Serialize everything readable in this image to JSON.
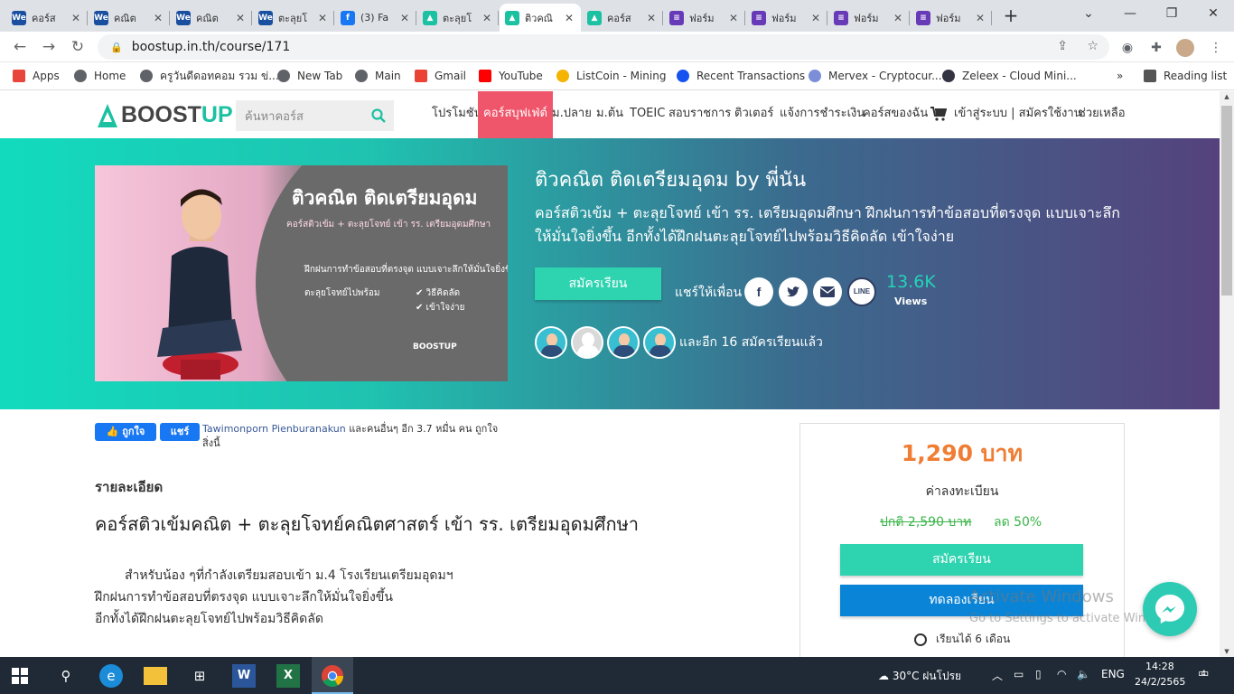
{
  "browser": {
    "tabs": [
      {
        "label": "คอร์ส",
        "icon": "we-icon",
        "color": "#1a4fa0"
      },
      {
        "label": "คณิต",
        "icon": "we-icon",
        "color": "#1a4fa0"
      },
      {
        "label": "คณิต",
        "icon": "we-icon",
        "color": "#1a4fa0"
      },
      {
        "label": "ตะลุยโ",
        "icon": "we-icon",
        "color": "#1a4fa0"
      },
      {
        "label": "(3) Fa",
        "icon": "facebook-icon",
        "color": "#1877f2"
      },
      {
        "label": "ตะลุยโ",
        "icon": "boostup-icon",
        "color": "#1bc1a1"
      },
      {
        "label": "ติวคณิ",
        "icon": "boostup-icon",
        "color": "#1bc1a1",
        "active": true
      },
      {
        "label": "คอร์ส",
        "icon": "boostup-icon",
        "color": "#1bc1a1"
      },
      {
        "label": "ฟอร์ม",
        "icon": "forms-icon",
        "color": "#673ab7"
      },
      {
        "label": "ฟอร์ม",
        "icon": "forms-icon",
        "color": "#673ab7"
      },
      {
        "label": "ฟอร์ม",
        "icon": "forms-icon",
        "color": "#673ab7"
      },
      {
        "label": "ฟอร์ม",
        "icon": "forms-icon",
        "color": "#673ab7"
      }
    ],
    "url": "boostup.in.th/course/171",
    "bookmarks": [
      {
        "label": "Apps",
        "icon": "apps-grid-icon"
      },
      {
        "label": "Home",
        "icon": "globe-icon"
      },
      {
        "label": "ครูวันดีดอทคอม รวม ข่...",
        "icon": "globe-icon"
      },
      {
        "label": "New Tab",
        "icon": "globe-icon"
      },
      {
        "label": "Main",
        "icon": "globe-icon"
      },
      {
        "label": "Gmail",
        "icon": "gmail-icon"
      },
      {
        "label": "YouTube",
        "icon": "youtube-icon"
      },
      {
        "label": "ListCoin - Mining",
        "icon": "listcoin-icon"
      },
      {
        "label": "Recent Transactions",
        "icon": "coinbase-icon"
      },
      {
        "label": "Mervex - Cryptocur...",
        "icon": "mervex-icon"
      },
      {
        "label": "Zeleex - Cloud Mini...",
        "icon": "zeleex-icon"
      }
    ],
    "more_bookmarks": "»",
    "reading_list": "Reading list"
  },
  "site": {
    "logo_a": "BOOST",
    "logo_b": "UP",
    "search_placeholder": "ค้นหาคอร์ส",
    "menu": [
      "โปรโมชัน",
      "คอร์สบุฟเฟ่ต์",
      "ม.ปลาย",
      "ม.ต้น",
      "TOEIC",
      "สอบราชการ",
      "ติวเตอร์",
      "แจ้งการชำระเงิน",
      "คอร์สของฉัน",
      "เข้าสู่ระบบ | สมัครใช้งาน",
      "ช่วยเหลือ"
    ]
  },
  "hero": {
    "image_title": "ติวคณิต ติดเตรียมอุดม",
    "image_sub": "คอร์สติวเข้ม + ตะลุยโจทย์ เข้า รร. เตรียมอุดมศึกษา",
    "image_line1": "ฝึกฝนการทำข้อสอบที่ตรงจุด แบบเจาะลึกให้มั่นใจยิ่งขึ้น",
    "image_line2": "ตะลุยโจทย์ไปพร้อม",
    "image_check1": "✔  วิธีคิดลัด",
    "image_check2": "✔  เข้าใจง่าย",
    "image_brand": "BOOSTUP",
    "title": "ติวคณิต ติดเตรียมอุดม by พี่นัน",
    "description": "คอร์สติวเข้ม + ตะลุยโจทย์ เข้า รร. เตรียมอุดมศึกษา ฝึกฝนการทำข้อสอบที่ตรงจุด แบบเจาะลึกให้มั่นใจยิ่งขึ้น อีกทั้งได้ฝึกฝนตะลุยโจทย์ไปพร้อมวิธีคิดลัด เข้าใจง่าย",
    "apply_label": "สมัครเรียน",
    "share_label": "แชร์ให้เพื่อน",
    "views_count": "13.6K",
    "views_label": "Views",
    "students_more": "และอีก 16 สมัครเรียนแล้ว"
  },
  "content": {
    "fb_like": "ถูกใจ",
    "fb_share": "แชร์",
    "fb_name": "Tawimonporn Pienburanakun",
    "fb_rest": " และคนอื่นๆ อีก 3.7 หมื่น คน ถูกใจสิ่งนี้",
    "section_label": "รายละเอียด",
    "course_heading": "คอร์สติวเข้มคณิต + ตะลุยโจทย์คณิตศาสตร์ เข้า รร. เตรียมอุดมศึกษา",
    "para_line1": "สำหรับน้อง ๆที่กำลังเตรียมสอบเข้า ม.4 โรงเรียนเตรียมอุดมฯ",
    "para_line2": "ฝึกฝนการทำข้อสอบที่ตรงจุด แบบเจาะลึกให้มั่นใจยิ่งขึ้น",
    "para_line3": "อีกทั้งได้ฝึกฝนตะลุยโจทย์ไปพร้อมวิธีคิดลัด"
  },
  "pricing": {
    "price": "1,290 บาท",
    "price_label": "ค่าลงทะเบียน",
    "original": "ปกติ 2,590 บาท",
    "discount": "ลด 50%",
    "apply_label": "สมัครเรียน",
    "trial_label": "ทดลองเรียน",
    "study_time": "เรียนได้ 6 เดือน"
  },
  "watermark": {
    "line1": "Activate Windows",
    "line2": "Go to Settings to activate Windows."
  },
  "taskbar": {
    "weather": "30°C  ฝนโปรย",
    "lang": "ENG",
    "time": "14:28",
    "date": "24/2/2565",
    "notif_count": "4"
  },
  "colors": {
    "accent": "#1bc1a1",
    "menu_hot": "#f0566b",
    "price": "#f07d34",
    "discount": "#3bb549",
    "trial": "#0a84d6"
  }
}
